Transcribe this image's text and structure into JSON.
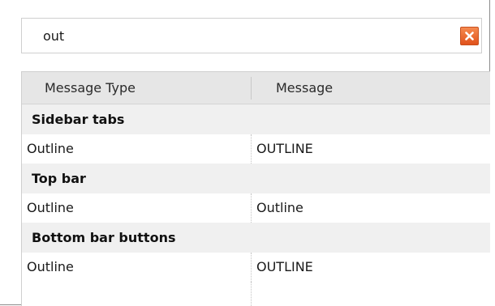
{
  "search": {
    "value": "out",
    "clear_label": "×"
  },
  "table": {
    "columns": [
      "Message Type",
      "Message"
    ],
    "groups": [
      {
        "name": "Sidebar tabs",
        "rows": [
          {
            "type": "Outline",
            "message": "OUTLINE"
          }
        ]
      },
      {
        "name": "Top bar",
        "rows": [
          {
            "type": "Outline",
            "message": "Outline"
          }
        ]
      },
      {
        "name": "Bottom bar buttons",
        "rows": [
          {
            "type": "Outline",
            "message": "OUTLINE"
          }
        ]
      }
    ]
  },
  "colors": {
    "clear_button": "#e8642a",
    "header_bg": "#e6e6e6",
    "group_bg": "#f0f0f0"
  }
}
